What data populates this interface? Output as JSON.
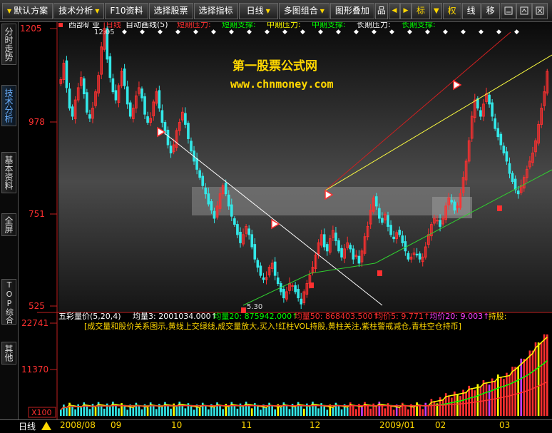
{
  "toolbar": {
    "buttons": [
      {
        "label": "默认方案"
      },
      {
        "label": "技术分析"
      },
      {
        "label": "F10资料"
      },
      {
        "label": "选择股票"
      },
      {
        "label": "选择指标"
      },
      {
        "label": "日线"
      },
      {
        "label": "多图组合"
      },
      {
        "label": "图形叠加"
      },
      {
        "label": "品"
      },
      {
        "label": "标"
      },
      {
        "label": "权"
      },
      {
        "label": "线"
      },
      {
        "label": "移"
      }
    ]
  },
  "sidebar": {
    "tabs": [
      {
        "label": "分时走势",
        "active": false
      },
      {
        "label": "技术分析",
        "active": true
      },
      {
        "label": "基本资料",
        "active": false
      },
      {
        "label": "全屏",
        "active": false
      },
      {
        "label": "TOP综合",
        "active": false
      },
      {
        "label": "其他",
        "active": false
      }
    ]
  },
  "main_header": {
    "stock": "西部矿业",
    "period": "日线",
    "formula": "自动画线(5)",
    "items": [
      {
        "text": "短期压力:",
        "color": "#ff3030"
      },
      {
        "text": "短期支撑:",
        "color": "#00ff00"
      },
      {
        "text": "中期压力:",
        "color": "#ffff00"
      },
      {
        "text": "中期支撑:",
        "color": "#00ff00"
      },
      {
        "text": "长期压力:",
        "color": "#ffffff"
      },
      {
        "text": "长期支撑:",
        "color": "#00ff00"
      }
    ]
  },
  "watermark": {
    "line1": "第一股票公式网",
    "line2": "www.chnmoney.com",
    "color": "#ffd700"
  },
  "volume_header": {
    "name": "五彩量价(5,20,4)",
    "items": [
      {
        "text": "均量3: 2001034.000↑",
        "color": "#ffffff"
      },
      {
        "text": "均量20: 875942.000↑",
        "color": "#00ff00"
      },
      {
        "text": "均量50: 868403.500↑",
        "color": "#ff3030"
      },
      {
        "text": "均价5: 9.771↑",
        "color": "#ff3030"
      },
      {
        "text": "均价20: 9.003↑",
        "color": "#ff40ff"
      },
      {
        "text": "持股:",
        "color": "#ffd700"
      }
    ],
    "note": "[成交量和股价关系图示,黄线上交绿线,成交量放大,买入!红柱VOL持股,黄柱关注,紫柱警戒减仓,青柱空仓持币]"
  },
  "footer": {
    "period_label": "日线",
    "dates": [
      "2008/08",
      "09",
      "10",
      "11",
      "12",
      "2009/01",
      "02",
      "03"
    ]
  },
  "chart_data": [
    {
      "type": "candlestick",
      "title": "",
      "y_axis_labels": [
        "1205",
        "978",
        "751",
        "525"
      ],
      "ylim": [
        525,
        1205
      ],
      "x_ticks": [
        "2008/08",
        "09",
        "10",
        "11",
        "12",
        "2009/01",
        "02",
        "03"
      ],
      "annotations": [
        {
          "text": "12.05",
          "value": 12.05
        },
        {
          "text": "5.30",
          "value": 5.3
        }
      ],
      "colors": {
        "up": "#ff3030",
        "down": "#33e8e8"
      },
      "close": [
        1080,
        1120,
        1060,
        1010,
        990,
        1030,
        1060,
        1085,
        1045,
        1000,
        985,
        1010,
        1050,
        1090,
        1160,
        1205,
        1130,
        1085,
        1050,
        1030,
        1065,
        1100,
        1065,
        1020,
        990,
        1010,
        1040,
        1060,
        1035,
        995,
        975,
        985,
        1025,
        1050,
        1010,
        975,
        950,
        920,
        900,
        920,
        955,
        975,
        1000,
        970,
        935,
        905,
        880,
        860,
        840,
        820,
        800,
        775,
        760,
        740,
        770,
        800,
        820,
        800,
        770,
        745,
        725,
        700,
        680,
        700,
        720,
        700,
        670,
        640,
        620,
        600,
        590,
        595,
        620,
        630,
        600,
        580,
        560,
        545,
        560,
        580,
        575,
        560,
        545,
        530,
        560,
        580,
        600,
        620,
        650,
        680,
        700,
        670,
        660,
        690,
        710,
        685,
        660,
        645,
        665,
        680,
        665,
        640,
        650,
        630,
        660,
        695,
        720,
        760,
        790,
        770,
        740,
        730,
        750,
        720,
        700,
        690,
        705,
        700,
        680,
        660,
        640,
        645,
        655,
        650,
        640,
        645,
        670,
        700,
        725,
        740,
        735,
        720,
        740,
        770,
        790,
        780,
        760,
        770,
        800,
        840,
        880,
        930,
        990,
        1030,
        1010,
        990,
        1020,
        1045,
        1020,
        990,
        960,
        940,
        920,
        900,
        880,
        850,
        830,
        810,
        800,
        820,
        840,
        860,
        880,
        900,
        930,
        970,
        1010,
        1050,
        1100
      ],
      "overlays": [
        {
          "name": "short-pressure",
          "color": "#d02020"
        },
        {
          "name": "mid-pressure",
          "color": "#ffff40"
        },
        {
          "name": "long-pressure",
          "color": "#ffffff"
        },
        {
          "name": "support",
          "color": "#30d030"
        }
      ]
    },
    {
      "type": "bar",
      "title": "五彩量价(5,20,4)",
      "y_axis_labels": [
        "22741",
        "11370"
      ],
      "ylim": [
        0,
        22741
      ],
      "unit_label": "X100",
      "series": [
        {
          "name": "均量3",
          "color": "#ffff00"
        },
        {
          "name": "均量20",
          "color": "#00ff00"
        },
        {
          "name": "均量50",
          "color": "#ff3030"
        }
      ],
      "bar_color_legend": [
        {
          "meaning": "红柱VOL持股",
          "color": "#ff3030"
        },
        {
          "meaning": "黄柱关注",
          "color": "#ffff00"
        },
        {
          "meaning": "紫柱警戒减仓",
          "color": "#c040ff"
        },
        {
          "meaning": "青柱空仓持币",
          "color": "#33e8e8"
        }
      ]
    }
  ]
}
